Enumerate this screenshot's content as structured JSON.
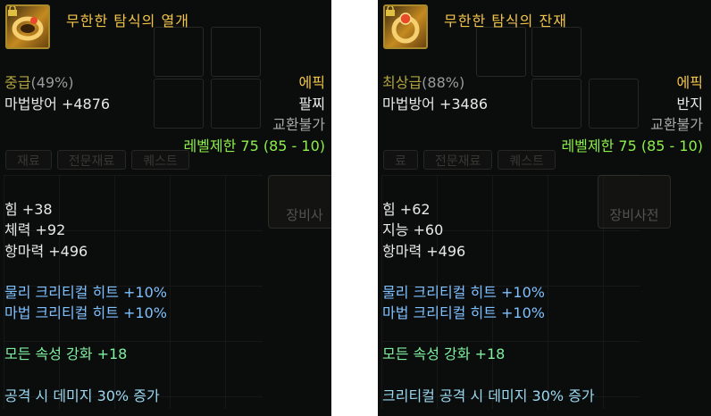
{
  "tooltips": [
    {
      "name": "무한한 탐식의 열개",
      "grade": "중급",
      "grade_percent": "(49%)",
      "rarity": "에픽",
      "main_stat": "마법방어 +4876",
      "slot": "팔찌",
      "trade": "교환불가",
      "level_limit": "레벨제한 75 (85 - 10)",
      "bg_tabs": [
        "재료",
        "전문재료",
        "퀘스트"
      ],
      "bg_button": "장비사",
      "stats": [
        "힘 +38",
        "체력 +92",
        "항마력 +496"
      ],
      "crit": [
        "물리 크리티컬 히트 +10%",
        "마법 크리티컬 히트 +10%"
      ],
      "element": "모든 속성 강화 +18",
      "option": "공격 시 데미지 30% 증가"
    },
    {
      "name": "무한한 탐식의 잔재",
      "grade": "최상급",
      "grade_percent": "(88%)",
      "rarity": "에픽",
      "main_stat": "마법방어 +3486",
      "slot": "반지",
      "trade": "교환불가",
      "level_limit": "레벨제한 75 (85 - 10)",
      "bg_tabs": [
        "료",
        "전문재료",
        "퀘스트"
      ],
      "bg_button": "장비사전",
      "stats": [
        "힘 +62",
        "지능 +60",
        "항마력 +496"
      ],
      "crit": [
        "물리 크리티컬 히트 +10%",
        "마법 크리티컬 히트 +10%"
      ],
      "element": "모든 속성 강화 +18",
      "option": "크리티컬 공격 시 데미지 30% 증가"
    }
  ],
  "colors": {
    "name": "#f2c54a",
    "grade": "#b2a53f",
    "level_limit": "#8cf04a",
    "crit": "#7fc0ff",
    "element": "#7ff0a0",
    "option": "#9ad8f0"
  }
}
